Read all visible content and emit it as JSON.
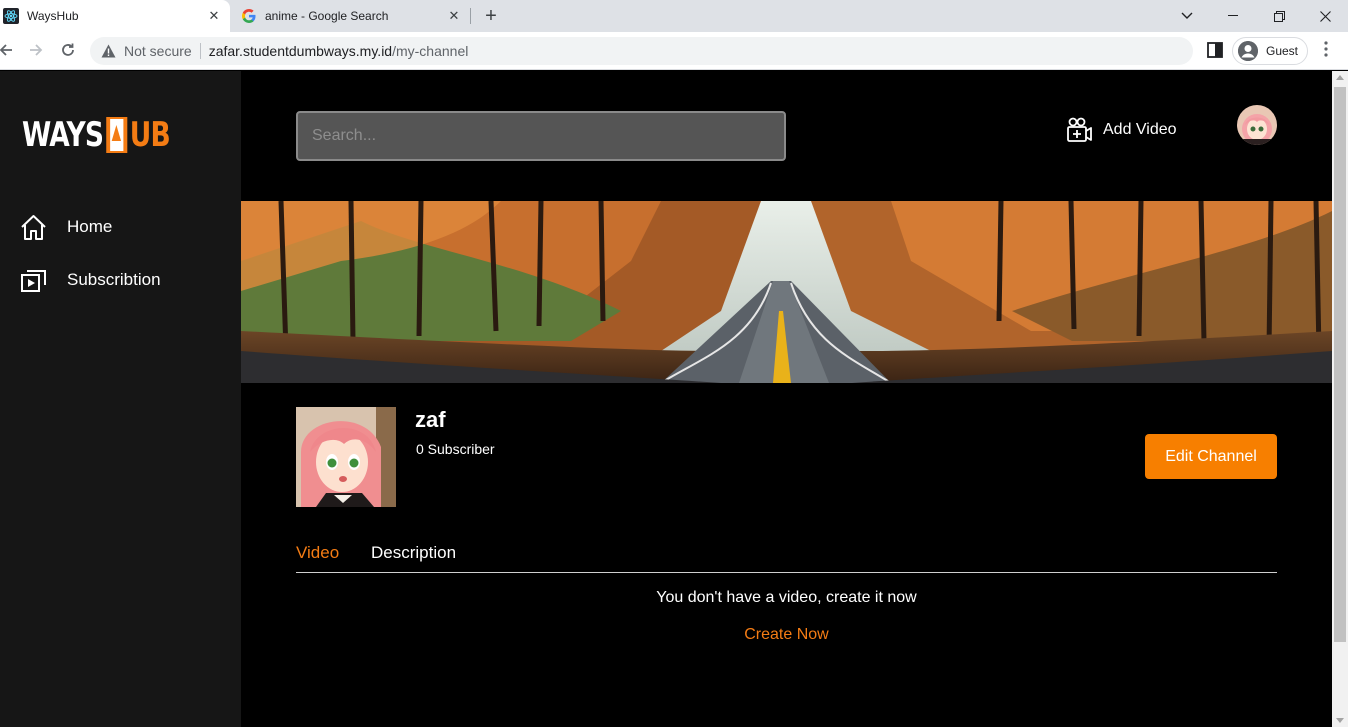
{
  "browser": {
    "tabs": [
      {
        "title": "WaysHub",
        "close": "✕"
      },
      {
        "title": "anime - Google Search",
        "close": "✕"
      }
    ],
    "new_tab": "+",
    "address": {
      "security": "Not secure",
      "host": "zafar.studentdumbways.my.id",
      "path": "/my-channel"
    },
    "profile": "Guest"
  },
  "app": {
    "logo": {
      "left": "WAYS",
      "right": "UB"
    },
    "sidebar": {
      "items": [
        {
          "label": "Home",
          "icon": "home-icon"
        },
        {
          "label": "Subscribtion",
          "icon": "subscription-icon"
        }
      ]
    },
    "header": {
      "search_placeholder": "Search...",
      "add_video_label": "Add Video"
    },
    "channel": {
      "name": "zaf",
      "subscribers": "0 Subscriber",
      "edit_label": "Edit Channel"
    },
    "tabs": [
      {
        "label": "Video",
        "active": true
      },
      {
        "label": "Description",
        "active": false
      }
    ],
    "empty_state": {
      "message": "You don't have a video, create it now",
      "action": "Create Now"
    },
    "colors": {
      "accent": "#f47c14",
      "sidebar_bg": "#161616",
      "main_bg": "#000000"
    }
  }
}
